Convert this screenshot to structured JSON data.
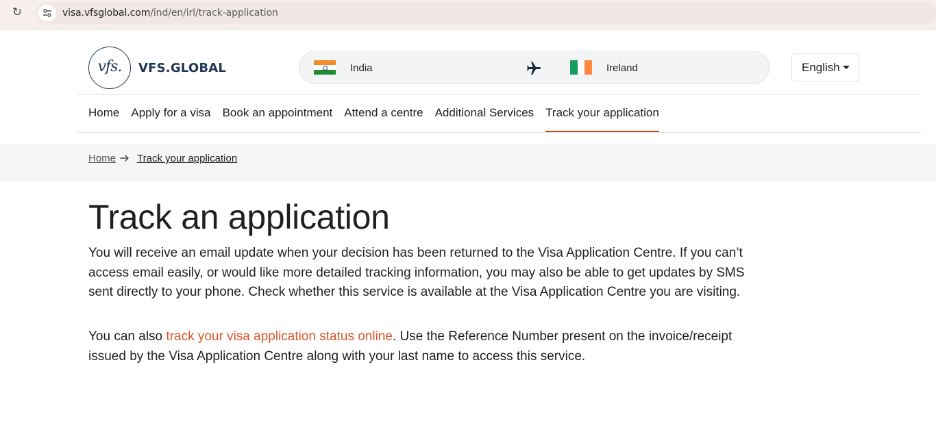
{
  "browser": {
    "url_host": "visa.vfsglobal.com",
    "url_path": "/ind/en/irl/track-application"
  },
  "header": {
    "logo_mark": "vfs.",
    "logo_text": "VFS.GLOBAL",
    "route": {
      "from": "India",
      "to": "Ireland"
    },
    "language": "English"
  },
  "nav": {
    "items": [
      "Home",
      "Apply for a visa",
      "Book an appointment",
      "Attend a centre",
      "Additional Services",
      "Track your application"
    ],
    "active_index": 5
  },
  "breadcrumb": {
    "home": "Home",
    "current": "Track your application"
  },
  "main": {
    "title": "Track an application",
    "para1": "You will receive an email update when your decision has been returned to the Visa Application Centre. If you can’t access email easily, or would like more detailed tracking information, you may also be able to get updates by SMS sent directly to your phone. Check whether this service is available at the Visa Application Centre you are visiting.",
    "para2_prefix": "You can also ",
    "para2_link": "track your visa application status online",
    "para2_suffix": ". Use the Reference Number present on the invoice/receipt issued by the Visa Application Centre along with your last name to access this service."
  },
  "colors": {
    "accent": "#d9562b",
    "brand_navy": "#1d3658",
    "active_underline": "#c0462a"
  }
}
